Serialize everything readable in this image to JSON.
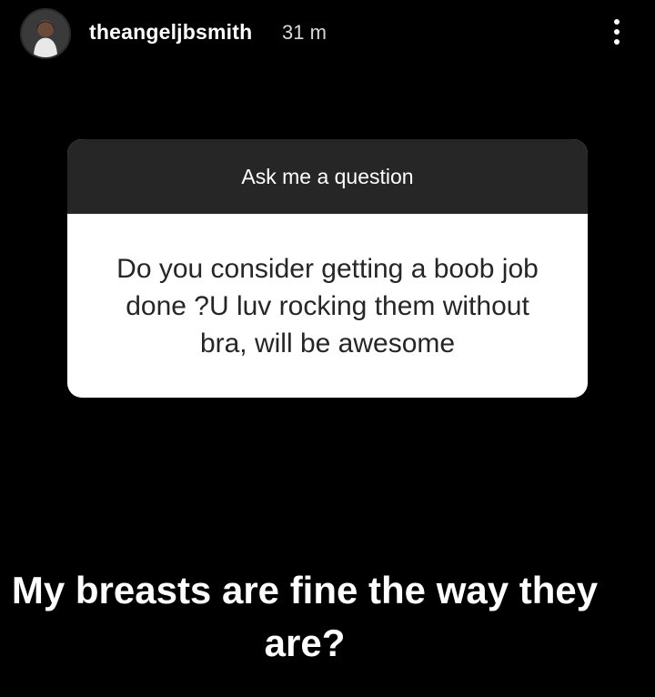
{
  "header": {
    "username": "theangeljbsmith",
    "timestamp": "31 m",
    "avatar_icon": "profile-avatar",
    "more_icon": "vertical-ellipsis-icon"
  },
  "question_sticker": {
    "title": "Ask me a question",
    "question": "Do you consider getting a boob job done ?U luv rocking them without bra, will be awesome"
  },
  "answer": {
    "text": "My breasts are fine the way they are?"
  },
  "colors": {
    "background": "#000000",
    "card_header": "#262626",
    "card_body": "#ffffff"
  }
}
